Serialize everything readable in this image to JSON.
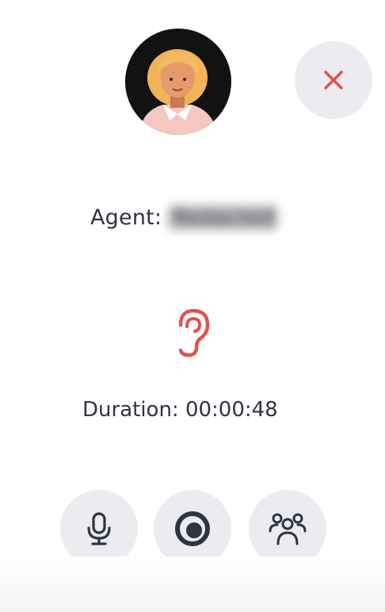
{
  "call": {
    "agent_label": "Agent:",
    "agent_name": "Redacted",
    "duration_text": "Duration: 00:00:48"
  },
  "icons": {
    "close": "close-icon",
    "ear": "ear-icon",
    "mic": "microphone-icon",
    "record": "record-icon",
    "participants": "participants-icon"
  },
  "colors": {
    "accent_red": "#e0524f",
    "icon_dark": "#2f3443",
    "button_bg": "#ececf0"
  }
}
